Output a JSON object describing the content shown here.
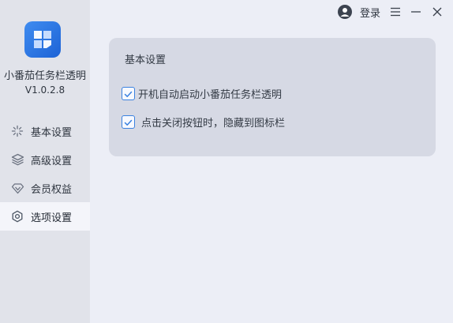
{
  "app": {
    "name": "小番茄任务栏透明",
    "version": "V1.0.2.8"
  },
  "titlebar": {
    "login_label": "登录"
  },
  "sidebar": {
    "items": [
      {
        "label": "基本设置",
        "icon": "sparkle-icon"
      },
      {
        "label": "高级设置",
        "icon": "layers-icon"
      },
      {
        "label": "会员权益",
        "icon": "diamond-icon"
      },
      {
        "label": "选项设置",
        "icon": "gear-icon",
        "active": true
      }
    ]
  },
  "main": {
    "section_title": "基本设置",
    "options": [
      {
        "label": "开机自动启动小番茄任务栏透明",
        "checked": true
      },
      {
        "label": "点击关闭按钮时，隐藏到图标栏",
        "checked": true
      }
    ]
  },
  "colors": {
    "accent": "#3b82e0",
    "sidebar_bg": "#e1e3ea",
    "window_bg": "#eceef6",
    "card_bg": "#d6d9e4"
  }
}
